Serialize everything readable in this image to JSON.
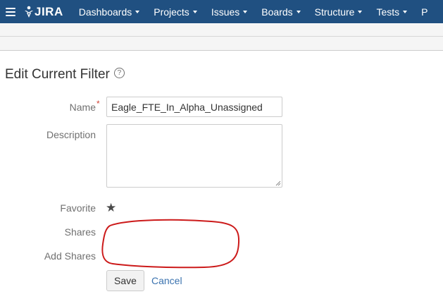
{
  "header": {
    "logo_text": "JIRA",
    "nav": [
      {
        "label": "Dashboards"
      },
      {
        "label": "Projects"
      },
      {
        "label": "Issues"
      },
      {
        "label": "Boards"
      },
      {
        "label": "Structure"
      },
      {
        "label": "Tests"
      },
      {
        "label": "P"
      }
    ]
  },
  "page": {
    "title": "Edit Current Filter",
    "help_icon": "?"
  },
  "form": {
    "name_label": "Name",
    "required_marker": "*",
    "name_value": "Eagle_FTE_In_Alpha_Unassigned",
    "description_label": "Description",
    "description_value": "",
    "favorite_label": "Favorite",
    "favorite_icon": "★",
    "shares_label": "Shares",
    "add_shares_label": "Add Shares",
    "save_label": "Save",
    "cancel_label": "Cancel"
  },
  "colors": {
    "header_bg": "#205081",
    "annotation": "#cc1a1a",
    "link": "#3b73af"
  }
}
